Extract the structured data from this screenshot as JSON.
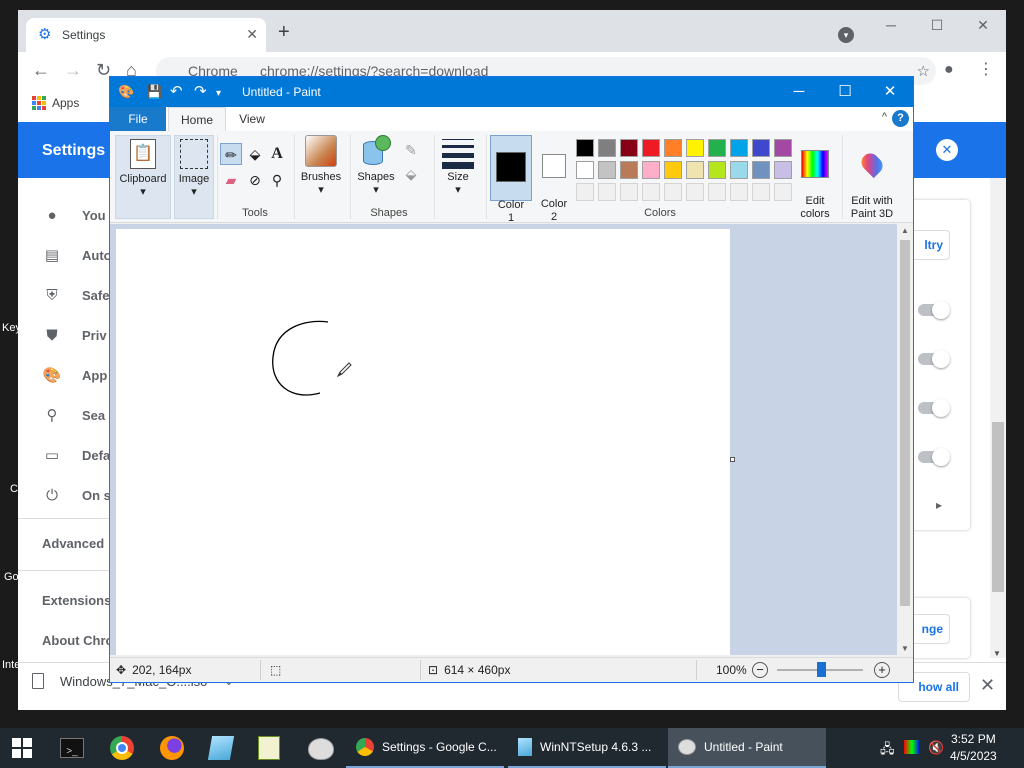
{
  "desktop": {
    "labels": [
      "Key",
      "C",
      "Go",
      "Inte"
    ]
  },
  "chrome": {
    "tab_title": "Settings",
    "omnibox_site": "Chrome",
    "omnibox_url": "chrome://settings/?search=download",
    "bookmarks_apps": "Apps",
    "settings_title": "Settings",
    "nav": [
      {
        "icon": "person-icon",
        "label": "You"
      },
      {
        "icon": "autofill-icon",
        "label": "Auto"
      },
      {
        "icon": "shield-check-icon",
        "label": "Safe"
      },
      {
        "icon": "shield-icon",
        "label": "Priv"
      },
      {
        "icon": "palette-icon",
        "label": "App"
      },
      {
        "icon": "search-icon",
        "label": "Sea"
      },
      {
        "icon": "browser-icon",
        "label": "Defa"
      },
      {
        "icon": "power-icon",
        "label": "On s"
      }
    ],
    "advanced": "Advanced",
    "extensions": "Extensions",
    "about": "About Chro",
    "retry_button": "ltry",
    "change_button": "nge",
    "download_file": "Windows_7_Mac_O....iso",
    "show_all": "how all"
  },
  "paint": {
    "title": "Untitled - Paint",
    "tabs": {
      "file": "File",
      "home": "Home",
      "view": "View"
    },
    "ribbon": {
      "clipboard": "Clipboard",
      "image": "Image",
      "tools_group": "Tools",
      "brushes": "Brushes",
      "shapes": "Shapes",
      "shapes_group": "Shapes",
      "size": "Size",
      "color1": "Color\n1",
      "color2": "Color\n2",
      "edit_colors": "Edit\ncolors",
      "edit_paint3d": "Edit with\nPaint 3D",
      "colors_group": "Colors"
    },
    "colors": {
      "color1": "#000000",
      "color2": "#ffffff",
      "palette_row1": [
        "#000000",
        "#7f7f7f",
        "#880015",
        "#ed1c24",
        "#ff7f27",
        "#fff200",
        "#22b14c",
        "#00a2e8",
        "#3f48cc",
        "#a349a4"
      ],
      "palette_row2": [
        "#ffffff",
        "#c3c3c3",
        "#b97a57",
        "#ffaec9",
        "#ffc90e",
        "#efe4b0",
        "#b5e61d",
        "#99d9ea",
        "#7092be",
        "#c8bfe7"
      ],
      "palette_row3": [
        "#f0f0f0",
        "#f0f0f0",
        "#f0f0f0",
        "#f0f0f0",
        "#f0f0f0",
        "#f0f0f0",
        "#f0f0f0",
        "#f0f0f0",
        "#f0f0f0",
        "#f0f0f0"
      ]
    },
    "status": {
      "cursor_pos": "202, 164px",
      "canvas_size": "614 × 460px",
      "zoom": "100%"
    }
  },
  "taskbar": {
    "tasks": [
      "Settings - Google C...",
      "WinNTSetup 4.6.3   ...",
      "Untitled - Paint"
    ],
    "time": "3:52 PM",
    "date": "4/5/2023"
  }
}
